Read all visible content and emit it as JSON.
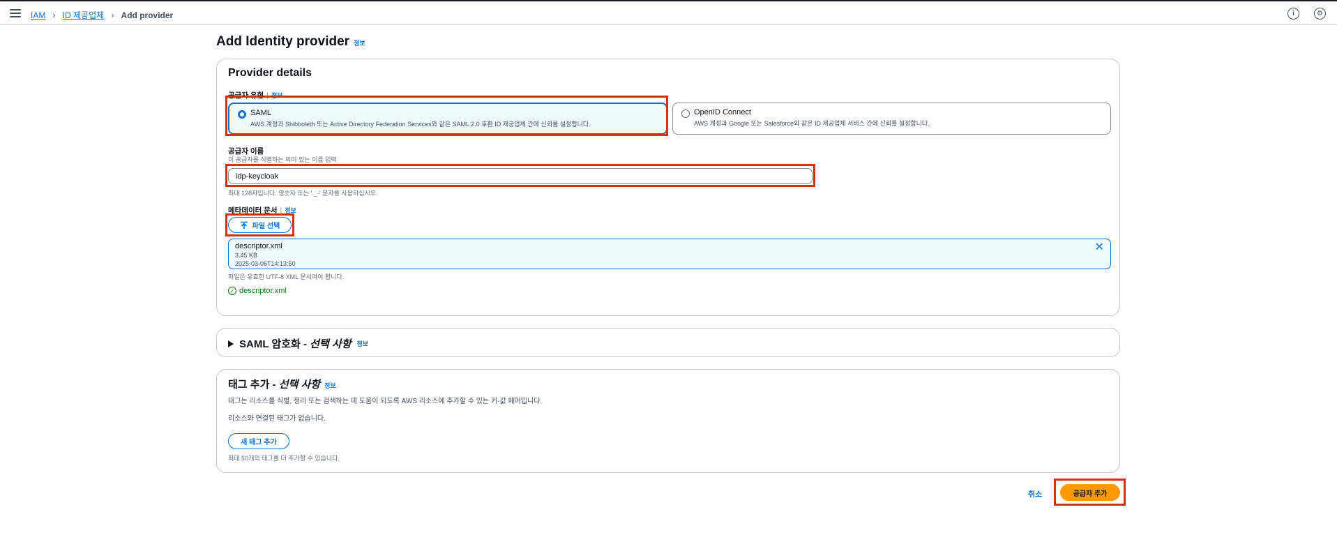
{
  "breadcrumbs": [
    {
      "label": "IAM"
    },
    {
      "label": "ID 제공업체"
    },
    {
      "label": "Add provider"
    }
  ],
  "topbar": {
    "info_icon": "info-icon",
    "settings_icon": "settings-icon"
  },
  "page": {
    "title": "Add Identity provider",
    "info": "정보"
  },
  "provider_details": {
    "title": "Provider details",
    "type_label": "공급자 유형",
    "type_info": "정보",
    "options": [
      {
        "title": "SAML",
        "desc": "AWS 계정과 Shibboleth 또는 Active Directory Federation Services와 같은 SAML 2.0 호환 ID 제공업체 간에 신뢰를 설정합니다.",
        "selected": true
      },
      {
        "title": "OpenID Connect",
        "desc": "AWS 계정과 Google 또는 Salesforce와 같은 ID 제공업체 서비스 간에 신뢰를 설정합니다.",
        "selected": false
      }
    ],
    "name_label": "공급자 이름",
    "name_desc": "이 공급자를 식별하는 의미 있는 이름 입력",
    "name_value": "idp-keycloak",
    "name_hint": "최대 128자입니다. 영숫자 또는 '._-' 문자를 사용하십시오.",
    "metadata_label": "메타데이터 문서",
    "metadata_info": "정보",
    "upload_label": "파일 선택",
    "file": {
      "name": "descriptor.xml",
      "size": "3.45 KB",
      "date": "2025-03-06T14:13:50"
    },
    "file_hint": "파일은 유효한 UTF-8 XML 문서여야 합니다.",
    "success_file": "descriptor.xml"
  },
  "saml_encryption": {
    "title": "SAML 암호화 - ",
    "optional": "선택 사항",
    "info": "정보"
  },
  "tags": {
    "title": "태그 추가 - ",
    "optional": "선택 사항",
    "info": "정보",
    "desc": "태그는 리소스를 식별, 정리 또는 검색하는 데 도움이 되도록 AWS 리소스에 추가할 수 있는 키-값 페어입니다.",
    "empty": "리소스와 연결된 태그가 없습니다.",
    "add_label": "새 태그 추가",
    "limit": "최대 50개의 태그를 더 추가할 수 있습니다."
  },
  "footer": {
    "cancel": "취소",
    "submit": "공급자 추가"
  },
  "colors": {
    "accent": "#0972d3",
    "primary": "#ff9900",
    "highlight": "#d13212",
    "success": "#037f0c"
  }
}
